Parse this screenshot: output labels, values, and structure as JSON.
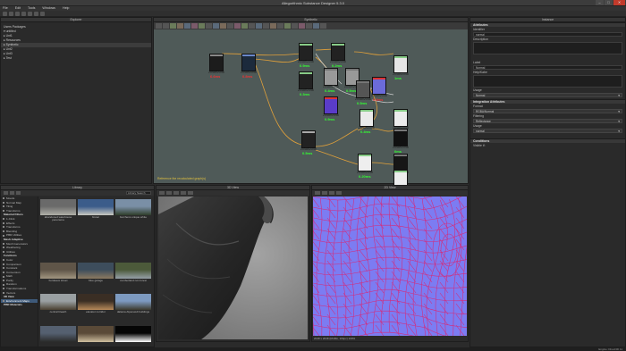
{
  "window": {
    "title": "Allegorithmic Substance Designer 5.3.0",
    "buttons": [
      "–",
      "□",
      "✕"
    ]
  },
  "menu": [
    "File",
    "Edit",
    "Tools",
    "Windows",
    "Help"
  ],
  "explorer": {
    "title": "Explorer",
    "tree": [
      "Users Packages",
      "▾ untitled",
      "  ▸ Unt1",
      "  ▸ Resources",
      "  ▸ Synthetic",
      "  ▸ Unt2",
      "  ▸ Unt3",
      "  ▸ Test"
    ]
  },
  "graph": {
    "title": "Synthetic",
    "status": "Reference the recalculated graph(s)",
    "nodes": [
      {
        "label": "2048x2048",
        "time": "6.6ms",
        "tc": "#e33",
        "thumb": "#1c1c1c",
        "hc": "#888"
      },
      {
        "label": "2048x2048",
        "time": "0.8ms",
        "tc": "#e33",
        "thumb": "#1c2a3c",
        "hc": "#6a87c9"
      },
      {
        "label": "2048x2048",
        "time": "0.9ms",
        "tc": "#3f3",
        "thumb": "#222",
        "hc": "#8c8"
      },
      {
        "label": "2048x2048",
        "time": "0.2ms",
        "tc": "#3f3",
        "thumb": "#222",
        "hc": "#8c8"
      },
      {
        "label": "2048x2048",
        "time": "0.4ms",
        "tc": "#3f3",
        "thumb": "#999",
        "hc": "#777"
      },
      {
        "label": "2048x2048",
        "time": "0.5ms",
        "tc": "#3f3",
        "thumb": "#999",
        "hc": "#777"
      },
      {
        "label": "2048x2048",
        "time": "0.3ms",
        "tc": "#3f3",
        "thumb": "#222",
        "hc": "#8c8"
      },
      {
        "label": "2048x2048",
        "time": "1ms",
        "tc": "#3f3",
        "thumb": "#e6e6e6",
        "hc": "#8c8"
      },
      {
        "label": "2048x2048",
        "time": "0.8ms",
        "tc": "#e33",
        "thumb": "#6b6bd9",
        "hc": "#d33"
      },
      {
        "label": "2048x2048",
        "time": "0.5ms",
        "tc": "#3f3",
        "thumb": "#555",
        "hc": "#777"
      },
      {
        "label": "2048x2048",
        "time": "0.9ms",
        "tc": "#3f3",
        "thumb": "#5a3cc9",
        "hc": "#d33"
      },
      {
        "label": "2048x2048",
        "time": "0.4ms",
        "tc": "#3f3",
        "thumb": "#eaeaea",
        "hc": "#8c8"
      },
      {
        "label": "2048x2048",
        "time": "0ms",
        "tc": "#3f3",
        "thumb": "#ececec",
        "hc": "#8c8"
      },
      {
        "label": "2048x2048",
        "time": "0ms",
        "tc": "#3f3",
        "thumb": "#111",
        "hc": "#777"
      },
      {
        "label": "2048x2048",
        "time": "0.5ms",
        "tc": "#3f3",
        "thumb": "#222",
        "hc": "#aaa"
      },
      {
        "label": "2048x2048",
        "time": "0.20ms",
        "tc": "#3f3",
        "thumb": "#eee",
        "hc": "#8c8"
      },
      {
        "label": "2048x2048",
        "time": "0.2ms",
        "tc": "#3f3",
        "thumb": "#161616",
        "hc": "#777"
      },
      {
        "label": "2048x2048",
        "time": "0ms",
        "tc": "#3f3",
        "thumb": "#ededed",
        "hc": "#8c8"
      }
    ]
  },
  "props": {
    "title": "Instance",
    "attributes_header": "Attributes",
    "identifier_label": "Identifier",
    "identifier_value": "normal",
    "description_label": "Description",
    "label_label": "Label",
    "label_value": "Normal",
    "help_label": "Help/Kabe",
    "usage_label": "Usage",
    "usage_value": "Normal",
    "integration_header": "Integration Attributes",
    "format_label": "Format",
    "format_value": "RGBA/Normal",
    "filtering_label": "Filtering",
    "filtering_value": "Reflectance",
    "usage2_label": "Usage",
    "usage2_value": "normal",
    "conditions_header": "Conditions",
    "visible_label": "Visible if:"
  },
  "library": {
    "title": "Library",
    "search": "Library Search",
    "categories": [
      {
        "t": "Moods",
        "h": false
      },
      {
        "t": "Normal Map",
        "h": false
      },
      {
        "t": "Tiling",
        "h": false
      },
      {
        "t": "Transforms",
        "h": false
      },
      {
        "t": "Material Filters",
        "h": true
      },
      {
        "t": "1-Click",
        "h": false
      },
      {
        "t": "Effects",
        "h": false
      },
      {
        "t": "Transforms",
        "h": false
      },
      {
        "t": "Blending",
        "h": false
      },
      {
        "t": "PBR Utilities",
        "h": false
      },
      {
        "t": "Mesh Adaptive",
        "h": true
      },
      {
        "t": "Mesh Generators",
        "h": false
      },
      {
        "t": "Weathering",
        "h": false
      },
      {
        "t": "Utilities",
        "h": false
      },
      {
        "t": "Functions",
        "h": true
      },
      {
        "t": "Color",
        "h": false
      },
      {
        "t": "Comparison",
        "h": false
      },
      {
        "t": "Constant",
        "h": false
      },
      {
        "t": "Conversion",
        "h": false
      },
      {
        "t": "Math",
        "h": false
      },
      {
        "t": "Parity",
        "h": false
      },
      {
        "t": "Random",
        "h": false
      },
      {
        "t": "Transformations",
        "h": false
      },
      {
        "t": "Vectors",
        "h": false
      },
      {
        "t": "3D View",
        "h": true
      },
      {
        "t": "Environment Maps",
        "h": false,
        "s": true
      },
      {
        "t": "PBR Materials",
        "h": true
      }
    ],
    "items": [
      {
        "cap": "abandoned warehouse panorama",
        "c1": "#6a6a6a",
        "c2": "#b0b0a8"
      },
      {
        "cap": "bisnet",
        "c1": "#3b5c8a",
        "c2": "#c9c9c0"
      },
      {
        "cap": "burchens unique white",
        "c1": "#7a8fa6",
        "c2": "#2f3d2a"
      },
      {
        "cap": "",
        "c1": "#2a2a2a",
        "c2": "#2a2a2a"
      },
      {
        "cap": "",
        "c1": "#2a2a2a",
        "c2": "#2a2a2a"
      },
      {
        "cap": "",
        "c1": "#2a2a2a",
        "c2": "#2a2a2a"
      },
      {
        "cap": "bordeaux street",
        "c1": "#5f5548",
        "c2": "#a29680"
      },
      {
        "cap": "blue garage",
        "c1": "#3d4d5c",
        "c2": "#8c7a60"
      },
      {
        "cap": "cumberland ruin forest",
        "c1": "#4c5a3a",
        "c2": "#96a0a8"
      },
      {
        "cap": "central bleach",
        "c1": "#9aa0a2",
        "c2": "#4a4030"
      },
      {
        "cap": "elevator corridor",
        "c1": "#3a2e24",
        "c2": "#b78a5a"
      },
      {
        "cap": "dalama Alpenwelt buildings",
        "c1": "#7d9ac0",
        "c2": "#3c3a2c"
      },
      {
        "cap": "",
        "c1": "#556070",
        "c2": "#2a2a28"
      },
      {
        "cap": "",
        "c1": "#5a4a38",
        "c2": "#d0c0a0"
      },
      {
        "cap": "",
        "c1": "#060606",
        "c2": "#ffffff"
      }
    ]
  },
  "view3d": {
    "title": "3D View"
  },
  "view2d": {
    "title": "2D View",
    "status": "2048 x 2048 (RGBA, 16bpc)  100%"
  },
  "statusbar": "Engine: Direct3D 11"
}
